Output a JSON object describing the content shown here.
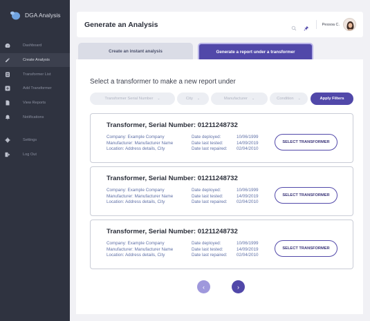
{
  "app": {
    "name": "DGA Analysis"
  },
  "sidebar": {
    "items": [
      {
        "label": "Dashboard",
        "icon": "gauge-icon"
      },
      {
        "label": "Create Analysis",
        "icon": "pencil-icon",
        "active": true
      },
      {
        "label": "Transformer List",
        "icon": "list-icon"
      },
      {
        "label": "Add Transformer",
        "icon": "plus-square-icon"
      },
      {
        "label": "View Reports",
        "icon": "document-icon"
      },
      {
        "label": "Notifications",
        "icon": "bell-icon"
      },
      {
        "label": "Settings",
        "icon": "gear-icon"
      },
      {
        "label": "Log Out",
        "icon": "logout-icon"
      }
    ]
  },
  "header": {
    "title": "Generate an Analysis",
    "user": "Pessoa C."
  },
  "tabs": [
    {
      "label": "Create an instant analysis",
      "active": false
    },
    {
      "label": "Generate a report under a transformer",
      "active": true
    }
  ],
  "main": {
    "section_title": "Select a transformer to make a new report under",
    "filters": [
      {
        "label": "Transformer Serial Number"
      },
      {
        "label": "City"
      },
      {
        "label": "Manufacturer"
      },
      {
        "label": "Condition"
      }
    ],
    "apply_label": "Apply Filters",
    "cards": [
      {
        "title": "Transformer, Serial Number: 01211248732",
        "company": "Company: Example Company",
        "manufacturer": "Manufacturer: Manufacturer Name",
        "location": "Location: Address details, City",
        "deployed_label": "Date deployed:",
        "tested_label": "Date last tested:",
        "repaired_label": "Date last repaired:",
        "deployed": "10/06/1999",
        "tested": "14/09/2019",
        "repaired": "02/04/2010",
        "button": "SELECT TRANSFORMER"
      },
      {
        "title": "Transformer, Serial Number: 01211248732",
        "company": "Company: Example Company",
        "manufacturer": "Manufacturer: Manufacturer Name",
        "location": "Location: Address details, City",
        "deployed_label": "Date deployed:",
        "tested_label": "Date last tested:",
        "repaired_label": "Date last repaired:",
        "deployed": "10/06/1999",
        "tested": "14/09/2019",
        "repaired": "02/04/2010",
        "button": "SELECT TRANSFORMER"
      },
      {
        "title": "Transformer, Serial Number: 01211248732",
        "company": "Company: Example Company",
        "manufacturer": "Manufacturer: Manufacturer Name",
        "location": "Location: Address details, City",
        "deployed_label": "Date deployed:",
        "tested_label": "Date last tested:",
        "repaired_label": "Date last repaired:",
        "deployed": "10/06/1999",
        "tested": "14/09/2019",
        "repaired": "02/04/2010",
        "button": "SELECT TRANSFORMER"
      }
    ]
  },
  "colors": {
    "sidebar": "#2f3340",
    "accent": "#5148a9",
    "accent_light": "#9f98dc"
  }
}
